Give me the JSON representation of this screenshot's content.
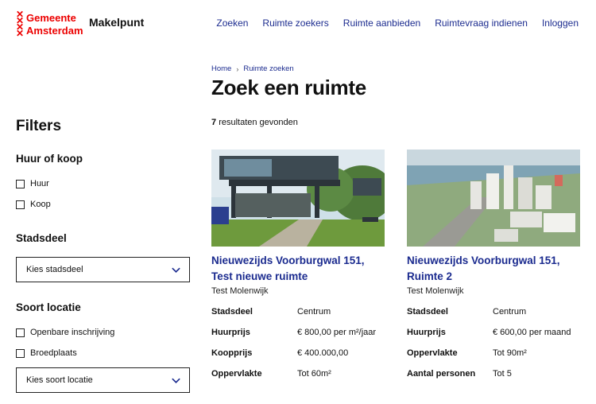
{
  "header": {
    "logo_line1": "Gemeente",
    "logo_line2": "Amsterdam",
    "app_name": "Makelpunt",
    "nav": [
      "Zoeken",
      "Ruimte zoekers",
      "Ruimte aanbieden",
      "Ruimtevraag indienen",
      "Inloggen"
    ]
  },
  "breadcrumb": {
    "home": "Home",
    "current": "Ruimte zoeken"
  },
  "page_title": "Zoek een ruimte",
  "results": {
    "count": "7",
    "label": "resultaten gevonden"
  },
  "filters": {
    "title": "Filters",
    "huur_koop": {
      "heading": "Huur of koop",
      "options": [
        "Huur",
        "Koop"
      ]
    },
    "stadsdeel": {
      "heading": "Stadsdeel",
      "select_value": "Kies stadsdeel"
    },
    "soort_locatie": {
      "heading": "Soort locatie",
      "options": [
        "Openbare inschrijving",
        "Broedplaats"
      ],
      "select_value": "Kies soort locatie"
    }
  },
  "cards": [
    {
      "title": "Nieuwezijds Voorburgwal 151, Test nieuwe ruimte",
      "subtitle": "Test Molenwijk",
      "props": [
        {
          "k": "Stadsdeel",
          "v": "Centrum"
        },
        {
          "k": "Huurprijs",
          "v": "€ 800,00 per m²/jaar"
        },
        {
          "k": "Koopprijs",
          "v": "€ 400.000,00"
        },
        {
          "k": "Oppervlakte",
          "v": "Tot 60m²"
        }
      ]
    },
    {
      "title": "Nieuwezijds Voorburgwal 151, Ruimte 2",
      "subtitle": "Test Molenwijk",
      "props": [
        {
          "k": "Stadsdeel",
          "v": "Centrum"
        },
        {
          "k": "Huurprijs",
          "v": "€ 600,00 per maand"
        },
        {
          "k": "Oppervlakte",
          "v": "Tot 90m²"
        },
        {
          "k": "Aantal personen",
          "v": "Tot 5"
        }
      ]
    }
  ],
  "colors": {
    "brand_red": "#ec0000",
    "link_blue": "#1b2b8f"
  }
}
